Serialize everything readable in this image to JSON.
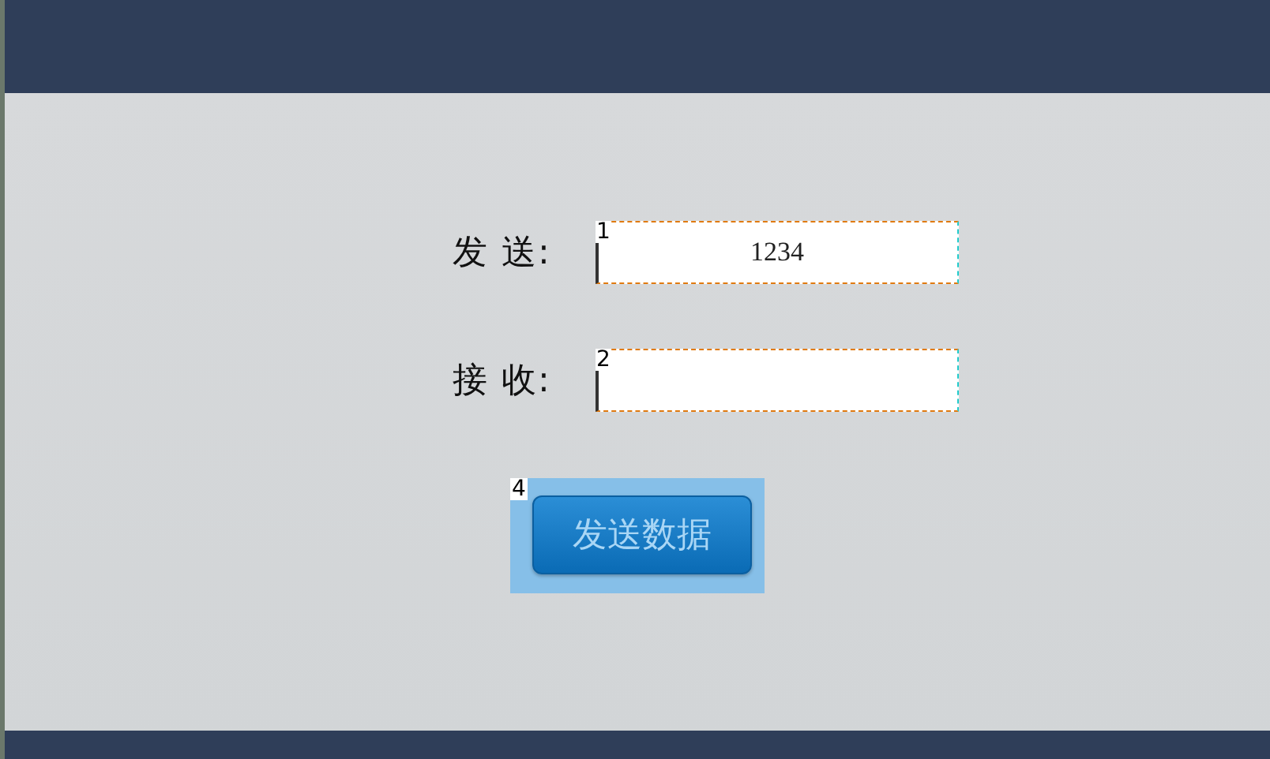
{
  "form": {
    "rows": [
      {
        "label": "发 送:",
        "badge": "1",
        "value": "1234"
      },
      {
        "label": "接 收:",
        "badge": "2",
        "value": ""
      }
    ],
    "button": {
      "label": "发送数据",
      "badge": "4"
    }
  }
}
